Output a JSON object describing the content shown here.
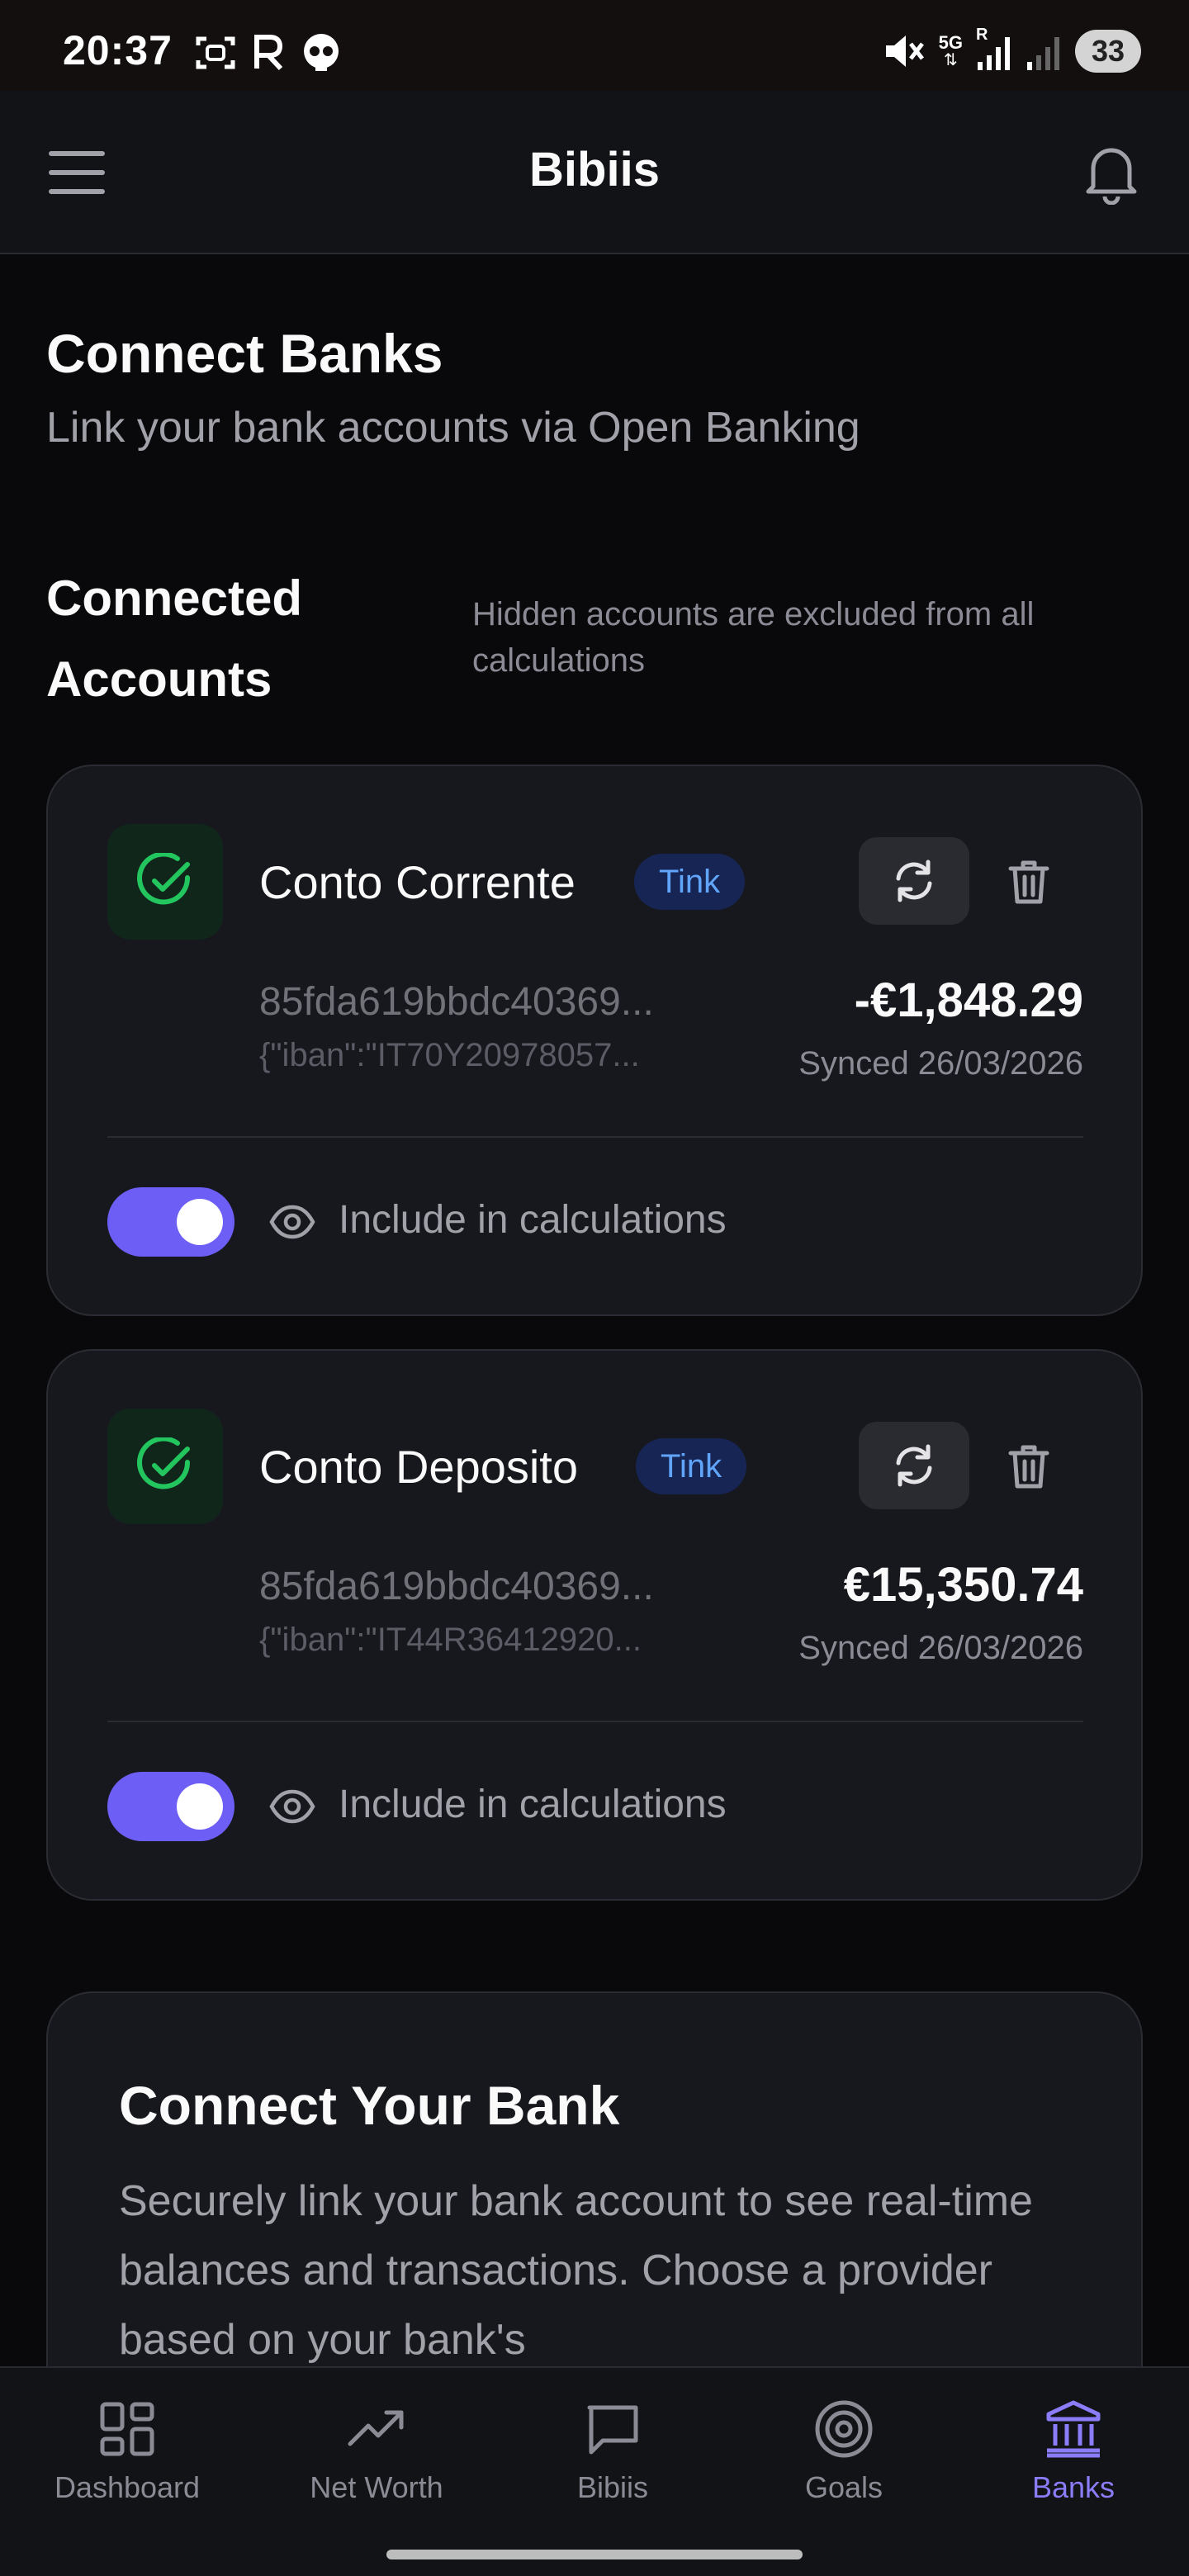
{
  "status_bar": {
    "time": "20:37",
    "network": "5G",
    "roaming": "R",
    "battery": "33",
    "icons": [
      "screenshot-icon",
      "r-app-icon",
      "skull-icon",
      "mute-icon",
      "signal-icon",
      "signal-weak-icon",
      "battery-icon"
    ]
  },
  "header": {
    "title": "Bibiis",
    "menu_icon": "hamburger-icon",
    "notifications_icon": "bell-icon"
  },
  "page": {
    "title": "Connect Banks",
    "subtitle": "Link your bank accounts via Open Banking"
  },
  "connected": {
    "title": "Connected Accounts",
    "note": "Hidden accounts are excluded from all calculations"
  },
  "accounts": [
    {
      "name": "Conto Corrente",
      "provider": "Tink",
      "id": "85fda619bbdc40369...",
      "iban": "{\"iban\":\"IT70Y20978057...",
      "balance": "-€1,848.29",
      "synced": "Synced 26/03/2026",
      "include_label": "Include in calculations",
      "included": true
    },
    {
      "name": "Conto Deposito",
      "provider": "Tink",
      "id": "85fda619bbdc40369...",
      "iban": "{\"iban\":\"IT44R36412920...",
      "balance": "€15,350.74",
      "synced": "Synced 26/03/2026",
      "include_label": "Include in calculations",
      "included": true
    }
  ],
  "connect": {
    "title": "Connect Your Bank",
    "text": "Securely link your bank account to see real-time balances and transactions. Choose a provider based on your bank's"
  },
  "nav": {
    "items": [
      {
        "label": "Dashboard",
        "icon": "dashboard-icon"
      },
      {
        "label": "Net Worth",
        "icon": "trending-up-icon"
      },
      {
        "label": "Bibiis",
        "icon": "chat-icon"
      },
      {
        "label": "Goals",
        "icon": "target-icon"
      },
      {
        "label": "Banks",
        "icon": "bank-icon"
      }
    ],
    "active": "Banks"
  },
  "colors": {
    "accent": "#6d5ef6",
    "success": "#22c55e",
    "badge_text": "#60a5fa",
    "background": "#09090b",
    "card": "#17181d"
  }
}
